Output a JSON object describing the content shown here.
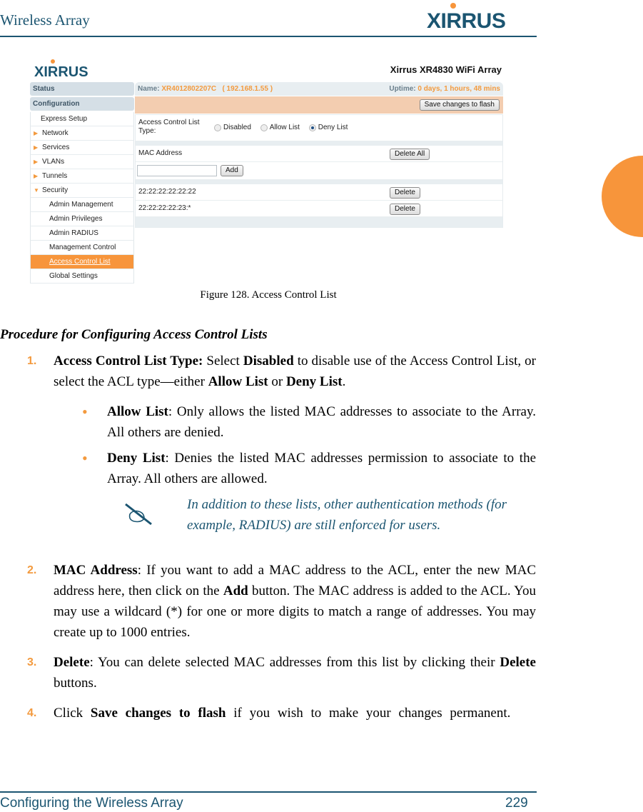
{
  "page_header": {
    "title": "Wireless Array",
    "logo": "XIRRUS"
  },
  "figure": {
    "logo": "XIRRUS",
    "device_title": "Xirrus XR4830 WiFi Array",
    "infobar": {
      "name_label": "Name:",
      "name_value": "XR4012802207C",
      "ip_value": "( 192.168.1.55 )",
      "uptime_label": "Uptime:",
      "uptime_value": "0 days, 1 hours, 48 mins"
    },
    "save_button": "Save changes to flash",
    "nav": {
      "top": [
        "Status",
        "Configuration"
      ],
      "items": [
        {
          "label": "Express Setup",
          "type": "plain"
        },
        {
          "label": "Network",
          "type": "collapsed"
        },
        {
          "label": "Services",
          "type": "collapsed"
        },
        {
          "label": "VLANs",
          "type": "collapsed"
        },
        {
          "label": "Tunnels",
          "type": "collapsed"
        },
        {
          "label": "Security",
          "type": "expanded"
        },
        {
          "label": "Admin Management",
          "type": "sub"
        },
        {
          "label": "Admin Privileges",
          "type": "sub"
        },
        {
          "label": "Admin RADIUS",
          "type": "sub"
        },
        {
          "label": "Management Control",
          "type": "sub"
        },
        {
          "label": "Access Control List",
          "type": "sub",
          "active": true
        },
        {
          "label": "Global Settings",
          "type": "sub"
        }
      ]
    },
    "form": {
      "acl_type_label": "Access Control List Type:",
      "radios": [
        {
          "label": "Disabled",
          "checked": false
        },
        {
          "label": "Allow List",
          "checked": false
        },
        {
          "label": "Deny List",
          "checked": true
        }
      ],
      "mac_address_label": "MAC Address",
      "delete_all_button": "Delete All",
      "mac_input_value": "",
      "add_button": "Add",
      "entries": [
        {
          "mac": "22:22:22:22:22:22",
          "delete_label": "Delete"
        },
        {
          "mac": "22:22:22:22:23:*",
          "delete_label": "Delete"
        }
      ]
    }
  },
  "caption": "Figure 128. Access Control List",
  "procedure_title": "Procedure for Configuring Access Control Lists",
  "steps": [
    {
      "num": "1.",
      "bold": "Access Control List Type:",
      "text_a": " Select ",
      "bold2": "Disabled",
      "text_b": " to disable use of the Access Control List, or select the ACL type—either ",
      "bold3": "Allow List",
      "text_c": " or ",
      "bold4": "Deny List",
      "text_d": "."
    },
    {
      "num": "2.",
      "bold": "MAC Address",
      "text_a": ": If you want to add a MAC address to the ACL, enter the new MAC address here, then click on the ",
      "bold2": "Add",
      "text_b": " button. The MAC address is added to the ACL. You may use a wildcard (*) for one or more digits to match a range of addresses. You may create up to 1000 entries."
    },
    {
      "num": "3.",
      "bold": "Delete",
      "text_a": ": You can delete selected MAC addresses from this list by clicking their ",
      "bold2": "Delete",
      "text_b": " buttons."
    },
    {
      "num": "4.",
      "text_a": "Click ",
      "bold": "Save changes to flash",
      "text_b": " if you wish to make your changes permanent."
    }
  ],
  "bullets": [
    {
      "bold": "Allow List",
      "text": ": Only allows the listed MAC addresses to associate to the Array. All others are denied."
    },
    {
      "bold": "Deny List",
      "text": ": Denies the listed MAC addresses permission to associate to the Array. All others are allowed."
    }
  ],
  "note": "In addition to these lists, other authentication methods (for example, RADIUS) are still enforced for users.",
  "footer": {
    "section": "Configuring the Wireless Array",
    "page": "229"
  },
  "colors": {
    "accent_orange": "#f7953b",
    "brand_teal": "#1b5571"
  }
}
